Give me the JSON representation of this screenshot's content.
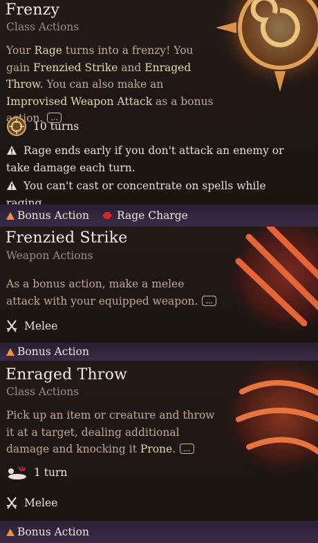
{
  "colors": {
    "keyword": "#e7d9a9",
    "description": "#c3a890",
    "subtitle": "#9c8d80",
    "bonus_triangle": "#f19437",
    "rage_charge": "#d6262b",
    "footer_bg": "#35273f"
  },
  "frenzy": {
    "title": "Frenzy",
    "subtitle": "Class Actions",
    "desc": {
      "p1": "Your ",
      "k1": "Rage",
      "p2": " turns into a frenzy! You gain ",
      "k2": "Frenzied Strike",
      "p3": " and ",
      "k3": "Enraged Throw",
      "p4": ". You can also make an ",
      "k4": "Improvised Weapon Attack",
      "p5": " as a bonus action."
    },
    "more_label": "...",
    "duration": "10 turns",
    "notes": [
      "Rage ends early if you don't attack an enemy or take damage each turn.",
      "You can't cast or concentrate on spells while raging."
    ],
    "cost": "Bonus Action",
    "charge": "Rage Charge"
  },
  "frenzied_strike": {
    "title": "Frenzied Strike",
    "subtitle": "Weapon Actions",
    "desc": "As a bonus action, make a melee attack with your equipped weapon.",
    "more_label": "...",
    "range": "Melee",
    "cost": "Bonus Action"
  },
  "enraged_throw": {
    "title": "Enraged Throw",
    "subtitle": "Class Actions",
    "desc_p1": "Pick up an item or creature and throw it at a target, dealing additional damage and knocking it ",
    "desc_k1": "Prone",
    "desc_p2": ".",
    "more_label": "...",
    "duration": "1 turn",
    "range": "Melee",
    "cost": "Bonus Action"
  },
  "icons": [
    "sun-sigil-art-icon",
    "claw-mark-art-icon",
    "duration-icon",
    "warning-icon",
    "bonus-action-triangle-icon",
    "rage-charge-icon",
    "crossed-swords-icon",
    "prone-icon"
  ]
}
